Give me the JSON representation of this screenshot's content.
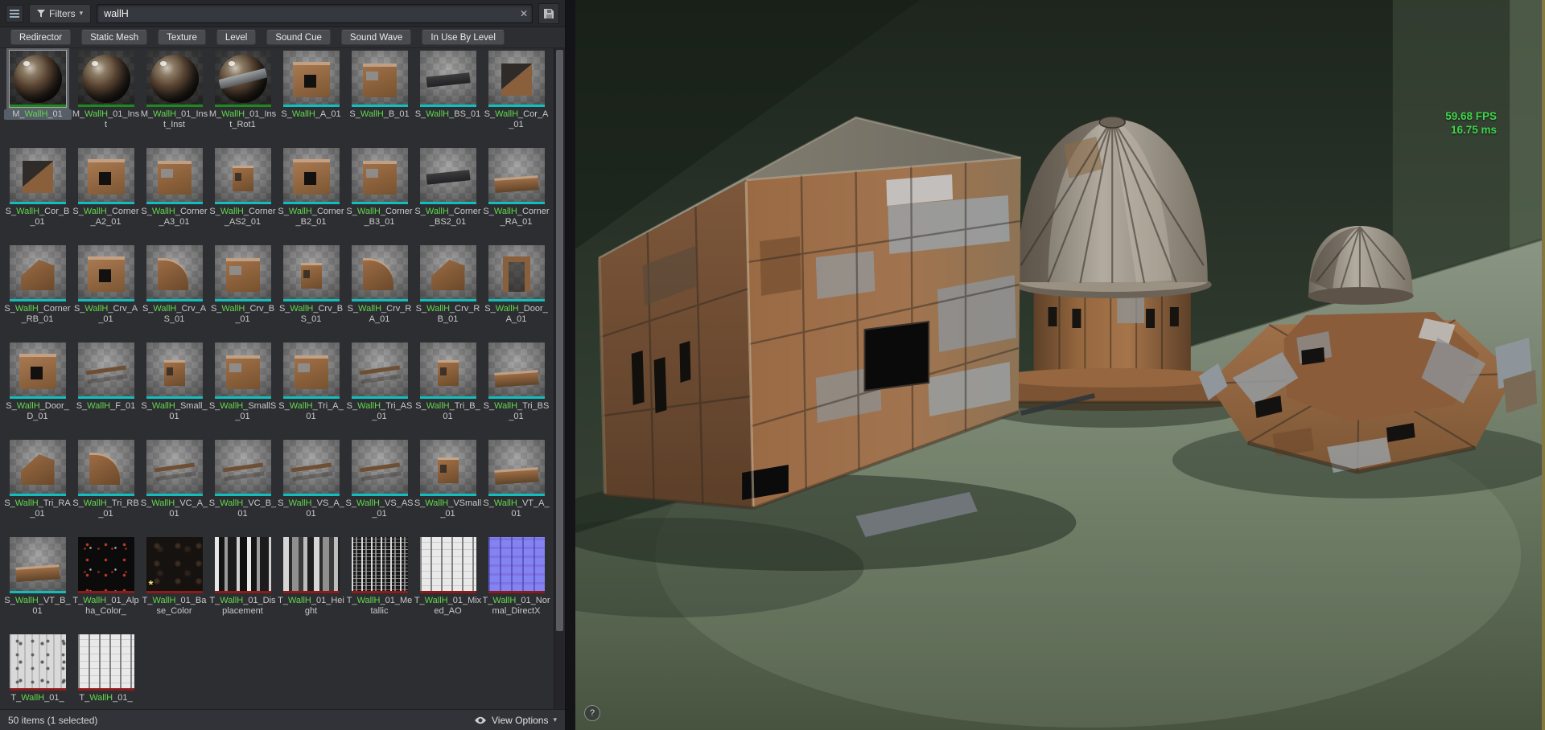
{
  "content_browser": {
    "toolbar": {
      "filters_label": "Filters",
      "filters_caret": "▾",
      "search_value": "wallH",
      "clear_glyph": "✕"
    },
    "filter_pills": [
      "Redirector",
      "Static Mesh",
      "Texture",
      "Level",
      "Sound Cue",
      "Sound Wave",
      "In Use By Level"
    ],
    "dirty_glyph": "*",
    "assets": [
      {
        "pre": "M_",
        "match": "WallH",
        "post": "_01",
        "kind": "material",
        "thumb": "sphere",
        "selected": true
      },
      {
        "pre": "M_",
        "match": "WallH",
        "post": "_01_Inst",
        "kind": "material",
        "thumb": "sphere"
      },
      {
        "pre": "M_",
        "match": "WallH",
        "post": "_01_Inst_Inst",
        "kind": "material",
        "thumb": "sphere"
      },
      {
        "pre": "M_",
        "match": "WallH",
        "post": "_01_Inst_Rot1",
        "kind": "material",
        "thumb": "sphere2"
      },
      {
        "pre": "S_",
        "match": "WallH",
        "post": "_A_01",
        "kind": "mesh",
        "thumb": "wallwin"
      },
      {
        "pre": "S_",
        "match": "WallH",
        "post": "_B_01",
        "kind": "mesh",
        "thumb": "wall"
      },
      {
        "pre": "S_",
        "match": "WallH",
        "post": "_BS_01",
        "kind": "mesh",
        "thumb": "slab"
      },
      {
        "pre": "S_",
        "match": "WallH",
        "post": "_Cor_A_01",
        "kind": "mesh",
        "thumb": "corner"
      },
      {
        "pre": "S_",
        "match": "WallH",
        "post": "_Cor_B_01",
        "kind": "mesh",
        "thumb": "corner"
      },
      {
        "pre": "S_",
        "match": "WallH",
        "post": "_Corner_A2_01",
        "kind": "mesh",
        "thumb": "wallwin"
      },
      {
        "pre": "S_",
        "match": "WallH",
        "post": "_Corner_A3_01",
        "kind": "mesh",
        "thumb": "wall"
      },
      {
        "pre": "S_",
        "match": "WallH",
        "post": "_Corner_AS2_01",
        "kind": "mesh",
        "thumb": "box"
      },
      {
        "pre": "S_",
        "match": "WallH",
        "post": "_Corner_B2_01",
        "kind": "mesh",
        "thumb": "wallwin"
      },
      {
        "pre": "S_",
        "match": "WallH",
        "post": "_Corner_B3_01",
        "kind": "mesh",
        "thumb": "wall"
      },
      {
        "pre": "S_",
        "match": "WallH",
        "post": "_Corner_BS2_01",
        "kind": "mesh",
        "thumb": "slab"
      },
      {
        "pre": "S_",
        "match": "WallH",
        "post": "_Corner_RA_01",
        "kind": "mesh",
        "thumb": "flat"
      },
      {
        "pre": "S_",
        "match": "WallH",
        "post": "_Corner_RB_01",
        "kind": "mesh",
        "thumb": "wedge"
      },
      {
        "pre": "S_",
        "match": "WallH",
        "post": "_Crv_A_01",
        "kind": "mesh",
        "thumb": "wallwin"
      },
      {
        "pre": "S_",
        "match": "WallH",
        "post": "_Crv_AS_01",
        "kind": "mesh",
        "thumb": "curve"
      },
      {
        "pre": "S_",
        "match": "WallH",
        "post": "_Crv_B_01",
        "kind": "mesh",
        "thumb": "wall"
      },
      {
        "pre": "S_",
        "match": "WallH",
        "post": "_Crv_BS_01",
        "kind": "mesh",
        "thumb": "box"
      },
      {
        "pre": "S_",
        "match": "WallH",
        "post": "_Crv_RA_01",
        "kind": "mesh",
        "thumb": "curve"
      },
      {
        "pre": "S_",
        "match": "WallH",
        "post": "_Crv_RB_01",
        "kind": "mesh",
        "thumb": "wedge"
      },
      {
        "pre": "S_",
        "match": "WallH",
        "post": "_Door_A_01",
        "kind": "mesh",
        "thumb": "frame"
      },
      {
        "pre": "S_",
        "match": "WallH",
        "post": "_Door_D_01",
        "kind": "mesh",
        "thumb": "wallwin"
      },
      {
        "pre": "S_",
        "match": "WallH",
        "post": "_F_01",
        "kind": "mesh",
        "thumb": "rod"
      },
      {
        "pre": "S_",
        "match": "WallH",
        "post": "_Small_01",
        "kind": "mesh",
        "thumb": "box"
      },
      {
        "pre": "S_",
        "match": "WallH",
        "post": "_SmallS_01",
        "kind": "mesh",
        "thumb": "wall"
      },
      {
        "pre": "S_",
        "match": "WallH",
        "post": "_Tri_A_01",
        "kind": "mesh",
        "thumb": "wall"
      },
      {
        "pre": "S_",
        "match": "WallH",
        "post": "_Tri_AS_01",
        "kind": "mesh",
        "thumb": "rod"
      },
      {
        "pre": "S_",
        "match": "WallH",
        "post": "_Tri_B_01",
        "kind": "mesh",
        "thumb": "box"
      },
      {
        "pre": "S_",
        "match": "WallH",
        "post": "_Tri_BS_01",
        "kind": "mesh",
        "thumb": "flat"
      },
      {
        "pre": "S_",
        "match": "WallH",
        "post": "_Tri_RA_01",
        "kind": "mesh",
        "thumb": "wedge"
      },
      {
        "pre": "S_",
        "match": "WallH",
        "post": "_Tri_RB_01",
        "kind": "mesh",
        "thumb": "curve"
      },
      {
        "pre": "S_",
        "match": "WallH",
        "post": "_VC_A_01",
        "kind": "mesh",
        "thumb": "rod"
      },
      {
        "pre": "S_",
        "match": "WallH",
        "post": "_VC_B_01",
        "kind": "mesh",
        "thumb": "rod"
      },
      {
        "pre": "S_",
        "match": "WallH",
        "post": "_VS_A_01",
        "kind": "mesh",
        "thumb": "rod"
      },
      {
        "pre": "S_",
        "match": "WallH",
        "post": "_VS_AS_01",
        "kind": "mesh",
        "thumb": "rod"
      },
      {
        "pre": "S_",
        "match": "WallH",
        "post": "_VSmall_01",
        "kind": "mesh",
        "thumb": "box"
      },
      {
        "pre": "S_",
        "match": "WallH",
        "post": "_VT_A_01",
        "kind": "mesh",
        "thumb": "flat"
      },
      {
        "pre": "S_",
        "match": "WallH",
        "post": "_VT_B_01",
        "kind": "mesh",
        "thumb": "flat"
      },
      {
        "pre": "T_",
        "match": "WallH",
        "post": "_01_Alpha_Color_",
        "kind": "texture",
        "thumb": "tex-alpha"
      },
      {
        "pre": "T_",
        "match": "WallH",
        "post": "_01_Base_Color",
        "kind": "texture",
        "thumb": "tex-base",
        "dirty": true
      },
      {
        "pre": "T_",
        "match": "WallH",
        "post": "_01_Displacement",
        "kind": "texture",
        "thumb": "tex-disp"
      },
      {
        "pre": "T_",
        "match": "WallH",
        "post": "_01_Height",
        "kind": "texture",
        "thumb": "tex-height"
      },
      {
        "pre": "T_",
        "match": "WallH",
        "post": "_01_Metallic",
        "kind": "texture",
        "thumb": "tex-metal"
      },
      {
        "pre": "T_",
        "match": "WallH",
        "post": "_01_Mixed_AO",
        "kind": "texture",
        "thumb": "tex-ao"
      },
      {
        "pre": "T_",
        "match": "WallH",
        "post": "_01_Normal_DirectX",
        "kind": "texture",
        "thumb": "tex-normal"
      },
      {
        "pre": "T_",
        "match": "WallH",
        "post": "_01_",
        "kind": "texture",
        "thumb": "tex-rough"
      },
      {
        "pre": "T_",
        "match": "WallH",
        "post": "_01_",
        "kind": "texture",
        "thumb": "tex-ao"
      }
    ],
    "status_bar": {
      "items_text": "50 items (1 selected)",
      "view_options_label": "View Options",
      "view_options_caret": "▾"
    }
  },
  "viewport": {
    "fps_text": "59.68 FPS",
    "ms_text": "16.75 ms",
    "stat_color": "#3fd44b",
    "help_glyph": "?"
  },
  "colors": {
    "match_highlight": "#62d84e",
    "mesh_strip": "#11bdbd",
    "material_strip": "#1e8a1e",
    "texture_strip": "#8f1a1a"
  }
}
